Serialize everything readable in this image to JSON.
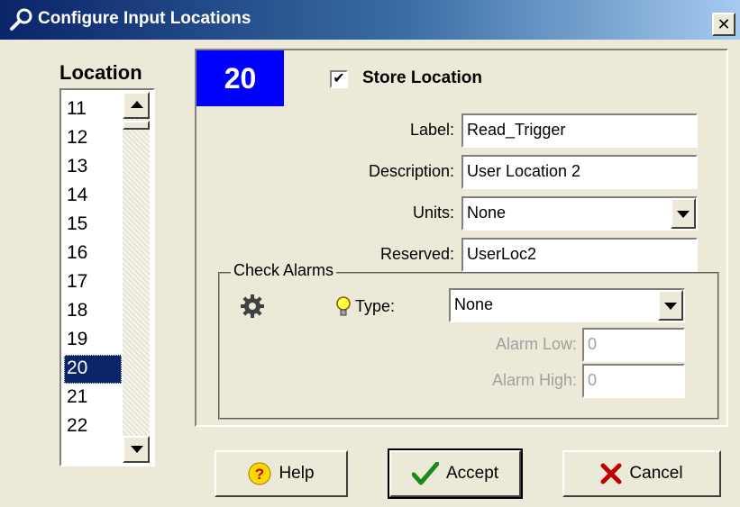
{
  "window": {
    "title": "Configure Input Locations",
    "close_glyph": "✕"
  },
  "location_list": {
    "heading": "Location",
    "items": [
      "11",
      "12",
      "13",
      "14",
      "15",
      "16",
      "17",
      "18",
      "19",
      "20",
      "21",
      "22"
    ],
    "selected": "20"
  },
  "location_number": "20",
  "store_location": {
    "label": "Store Location",
    "checked": true,
    "check_glyph": "✔"
  },
  "fields": {
    "label": {
      "label": "Label:",
      "value": "Read_Trigger"
    },
    "description": {
      "label": "Description:",
      "value": "User Location 2"
    },
    "units": {
      "label": "Units:",
      "value": "None"
    },
    "reserved": {
      "label": "Reserved:",
      "value": "UserLoc2"
    }
  },
  "check_alarms": {
    "title": "Check Alarms",
    "type_label": "Type:",
    "type_value": "None",
    "alarm_low_label": "Alarm Low:",
    "alarm_low_value": "0",
    "alarm_high_label": "Alarm High:",
    "alarm_high_value": "0"
  },
  "buttons": {
    "help": "Help",
    "accept": "Accept",
    "cancel": "Cancel"
  },
  "colors": {
    "title_gradient_start": "#0a246a",
    "location_badge": "#0000ff",
    "accept_check": "#1a8a1a",
    "cancel_x": "#c00000",
    "help_icon": "#ffd800"
  },
  "icons": [
    "wrench-icon",
    "gear-icon",
    "lightbulb-icon",
    "help-icon",
    "checkmark-icon",
    "red-x-icon",
    "scroll-up-icon",
    "scroll-down-icon",
    "dropdown-arrow-icon"
  ]
}
